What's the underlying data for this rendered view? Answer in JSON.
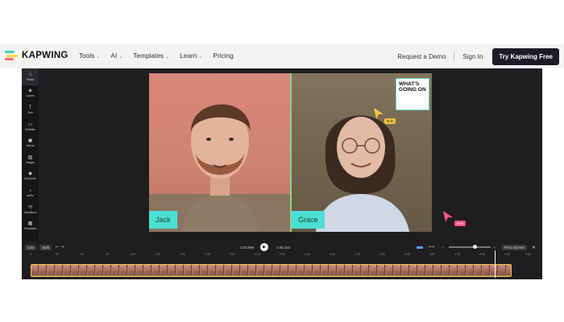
{
  "brand": {
    "name": "KAPWING",
    "colors": [
      "#ff6b6b",
      "#ffd93d",
      "#4ecdc4"
    ]
  },
  "nav": {
    "items": [
      {
        "label": "Tools",
        "dropdown": true
      },
      {
        "label": "AI",
        "dropdown": true
      },
      {
        "label": "Templates",
        "dropdown": true
      },
      {
        "label": "Learn",
        "dropdown": true
      },
      {
        "label": "Pricing",
        "dropdown": false
      }
    ],
    "chevron": "⌄",
    "request_demo": "Request a Demo",
    "sign_in": "Sign In",
    "cta": "Try Kapwing Free"
  },
  "sidebar": {
    "items": [
      {
        "label": "Media",
        "icon": "home-icon",
        "glyph": "⌂"
      },
      {
        "label": "Layers",
        "icon": "layers-icon",
        "glyph": "◈"
      },
      {
        "label": "Text",
        "icon": "text-icon",
        "glyph": "T"
      },
      {
        "label": "Subtitles",
        "icon": "subtitles-icon",
        "glyph": "▭"
      },
      {
        "label": "Videos",
        "icon": "videos-icon",
        "glyph": "▣"
      },
      {
        "label": "Images",
        "icon": "images-icon",
        "glyph": "▨"
      },
      {
        "label": "Elements",
        "icon": "elements-icon",
        "glyph": "◆"
      },
      {
        "label": "Audio",
        "icon": "audio-icon",
        "glyph": "♪"
      },
      {
        "label": "Transitions",
        "icon": "transitions-icon",
        "glyph": "⟲"
      },
      {
        "label": "Templates",
        "icon": "templates-icon",
        "glyph": "▦"
      }
    ],
    "settings_glyph": "⚙"
  },
  "canvas": {
    "left_name": "Jack",
    "right_name": "Grace",
    "bubble_text": "WHAT'S GOING ON",
    "cursor_erik": "Erik",
    "cursor_ken": "Ken",
    "erik_color": "#f5c542",
    "ken_color": "#ff4f86"
  },
  "controls": {
    "speed": "1.0x",
    "split": "Split",
    "current_time": "3:20.999",
    "total_time": "4:45.324",
    "fit": "Fit to Screen",
    "undo_glyph": "↩",
    "redo_glyph": "↪",
    "play_glyph": "▶",
    "close_glyph": "✕",
    "zoom_out_glyph": "−",
    "zoom_in_glyph": "+"
  },
  "ruler": [
    "0",
    ":15",
    ":30",
    ":45",
    "1:00",
    "1:15",
    "1:30",
    "1:45",
    "2:00",
    "2:15",
    "2:30",
    "2:45",
    "3:00",
    "3:15",
    "3:30",
    "3:45",
    "4:00",
    "4:15",
    "4:30",
    "4:45",
    "5:00"
  ]
}
